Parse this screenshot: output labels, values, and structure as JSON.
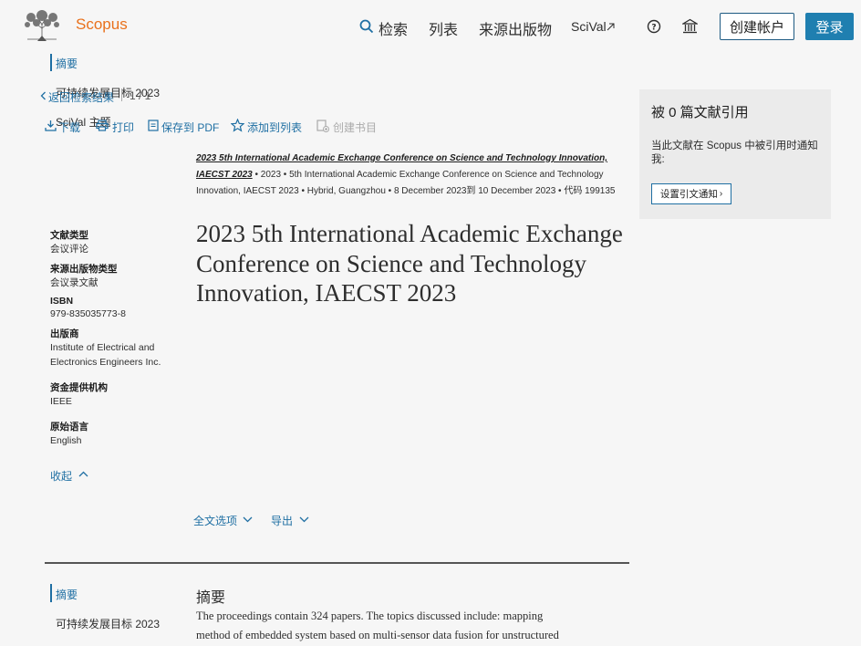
{
  "header": {
    "brand": "Scopus",
    "nav": {
      "search": "检索",
      "lists": "列表",
      "sources": "来源出版物",
      "scival": "SciVal"
    },
    "create_account": "创建帐户",
    "login": "登录"
  },
  "toc_overlay": {
    "abstract": "摘要",
    "sdg": "可持续发展目标 2023",
    "scival_topics": "SciVal 主题"
  },
  "back_nav": {
    "back_label": "返回检索结果",
    "pager": "1 / 1"
  },
  "toolbar": {
    "download": "下载",
    "print": "打印",
    "save_pdf": "保存到 PDF",
    "add_to_list": "添加到列表",
    "create_bib": "创建书目"
  },
  "source": {
    "title_line1": "2023 5th International Academic Exchange Conference on Science and Technology Innovation,",
    "title_line2": "IAECST 2023",
    "line2_rest": "• 2023 • 5th International Academic Exchange Conference on Science and Technology",
    "line3": "Innovation, IAECST 2023 • Hybrid, Guangzhou • 8 December 2023到 10 December 2023 • 代码 199135"
  },
  "meta": {
    "doc_type_label": "文献类型",
    "doc_type_value": "会议评论",
    "source_type_label": "来源出版物类型",
    "source_type_value": "会议录文献",
    "isbn_label": "ISBN",
    "isbn_value": "979-835035773-8",
    "publisher_label": "出版商",
    "publisher_line1": "Institute of Electrical and",
    "publisher_line2": "Electronics Engineers Inc.",
    "funding_label": "资金提供机构",
    "funding_value": "IEEE",
    "language_label": "原始语言",
    "language_value": "English",
    "collapse": "收起"
  },
  "document_title": "2023 5th International Academic Exchange Conference on Science and Technology Innovation, IAECST 2023",
  "options": {
    "full_text": "全文选项",
    "export": "导出"
  },
  "cited_panel": {
    "heading": "被 0 篇文献引用",
    "description": "当此文献在 Scopus 中被引用时通知我:",
    "alert_button": "设置引文通知"
  },
  "bottom_toc": {
    "abstract": "摘要",
    "sdg": "可持续发展目标 2023"
  },
  "abstract": {
    "heading": "摘要",
    "text_line1": "The proceedings contain 324 papers. The topics discussed include: mapping",
    "text_line2": "method of embedded system based on multi-sensor data fusion for unstructured"
  },
  "colors": {
    "brand_orange": "#e9711c",
    "link_blue": "#1f6fa3",
    "login_blue": "#1f7fb0"
  }
}
